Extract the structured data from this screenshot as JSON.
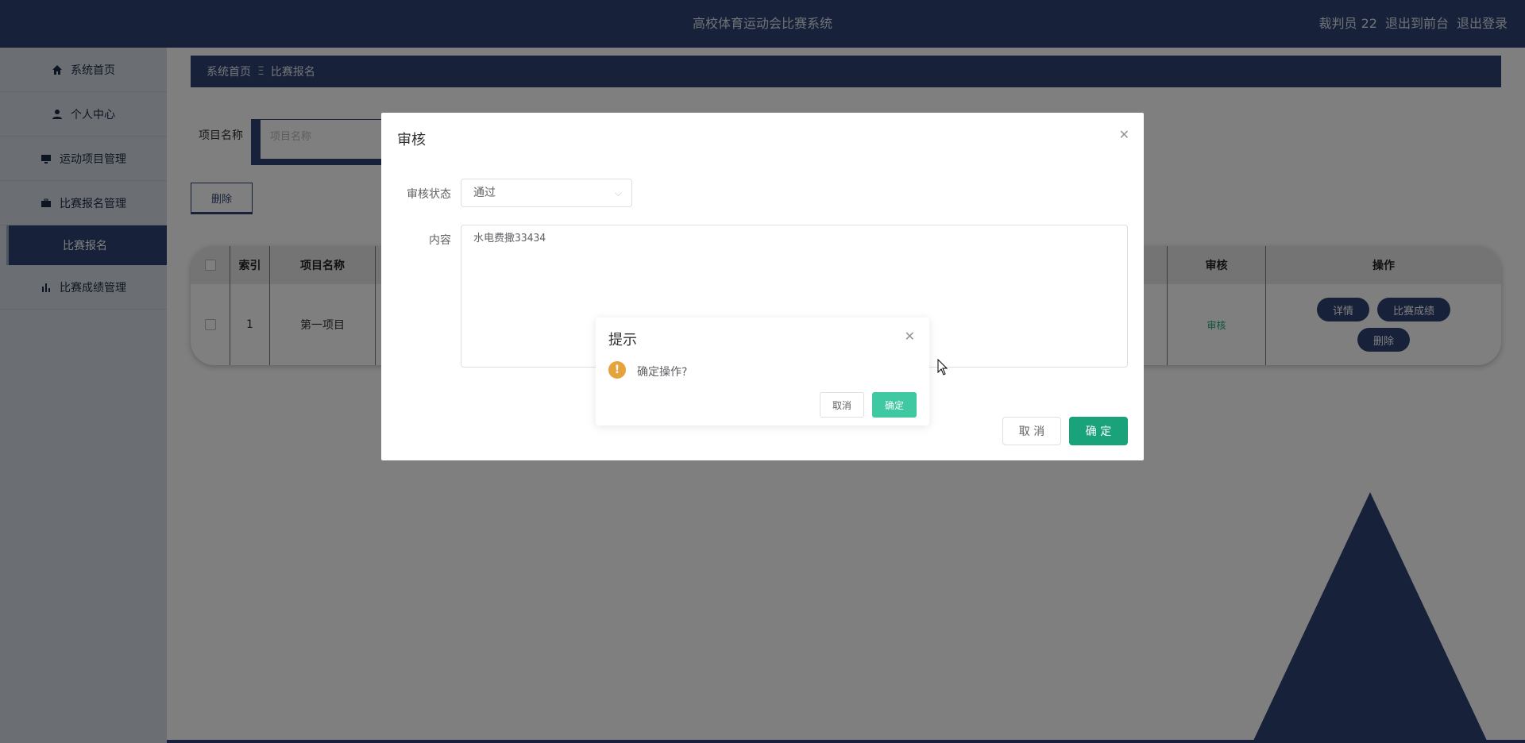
{
  "header": {
    "title": "高校体育运动会比赛系统",
    "user": "裁判员 22",
    "to_front": "退出到前台",
    "logout": "退出登录"
  },
  "sidebar": {
    "items": [
      {
        "label": "系统首页",
        "icon": "home-icon"
      },
      {
        "label": "个人中心",
        "icon": "user-icon"
      },
      {
        "label": "运动项目管理",
        "icon": "monitor-icon"
      },
      {
        "label": "比赛报名管理",
        "icon": "briefcase-icon"
      },
      {
        "label": "比赛成绩管理",
        "icon": "bar-chart-icon"
      }
    ],
    "active_sub": "比赛报名"
  },
  "breadcrumb": {
    "home": "系统首页",
    "separator": "Ξ",
    "current": "比赛报名"
  },
  "search": {
    "label": "项目名称",
    "placeholder": "项目名称"
  },
  "toolbar": {
    "delete_label": "删除"
  },
  "table": {
    "headers": {
      "index": "索引",
      "name": "项目名称",
      "audit": "审核",
      "ops": "操作"
    },
    "rows": [
      {
        "index": "1",
        "name": "第一项目",
        "audit": "审核",
        "ops": {
          "detail": "详情",
          "score": "比赛成绩",
          "delete": "删除"
        }
      }
    ]
  },
  "audit_dialog": {
    "title": "审核",
    "status_label": "审核状态",
    "status_value": "通过",
    "content_label": "内容",
    "content_value": "水电费撒33434",
    "cancel": "取 消",
    "ok": "确 定"
  },
  "confirm_box": {
    "title": "提示",
    "message": "确定操作?",
    "cancel": "取消",
    "ok": "确定"
  },
  "colors": {
    "primary": "#2e4372",
    "success": "#1aa37a",
    "warning": "#e6a23c"
  }
}
